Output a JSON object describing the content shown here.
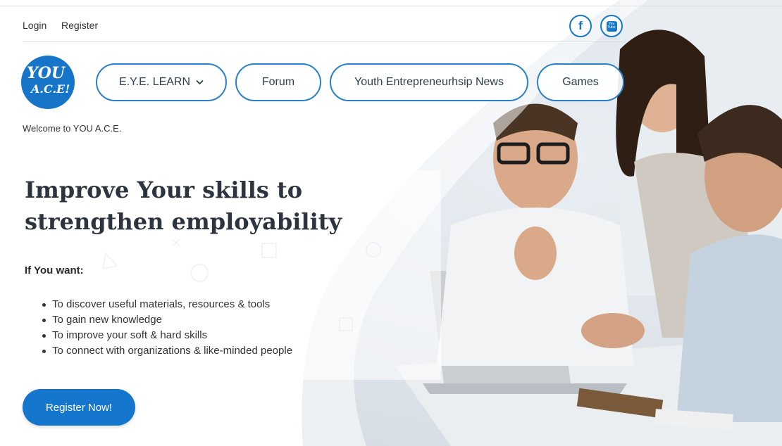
{
  "topbar": {
    "login": "Login",
    "register": "Register",
    "social": [
      {
        "icon": "facebook-icon",
        "glyph": "f"
      },
      {
        "icon": "youtube-icon",
        "glyph": "You Tube"
      }
    ]
  },
  "logo": {
    "line1": "YOU",
    "line2": "A.C.E!"
  },
  "nav": [
    {
      "label": "E.Y.E. LEARN",
      "has_dropdown": true
    },
    {
      "label": "Forum"
    },
    {
      "label": "Youth Entrepreneurhsip News"
    },
    {
      "label": "Games"
    }
  ],
  "welcome": "Welcome to YOU A.C.E.",
  "hero": {
    "title": "Improve Your skills to strengthen employability",
    "want_label": "If You want:",
    "bullets": [
      "To discover useful materials, resources & tools",
      "To gain new knowledge",
      "To improve your soft & hard skills",
      "To connect with organizations & like-minded people"
    ],
    "cta": "Register Now!"
  },
  "colors": {
    "accent": "#1476cc",
    "text": "#2d3440"
  }
}
